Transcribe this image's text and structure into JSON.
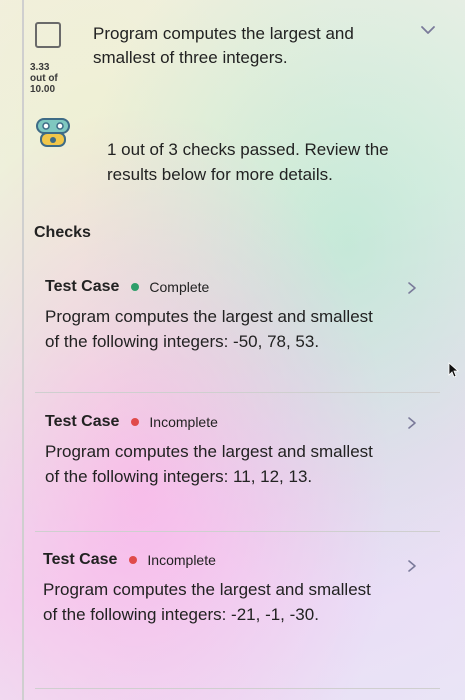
{
  "question": {
    "title": "Program computes the largest and smallest of three integers.",
    "score": "3.33",
    "score_out_of": "out of",
    "score_max": "10.00"
  },
  "summary": "1 out of 3 checks passed. Review the results below for more details.",
  "checks_heading": "Checks",
  "tests": [
    {
      "label": "Test Case",
      "status": "Complete",
      "status_color": "#2e9e6a",
      "description": "Program computes the largest and smallest of the following integers: -50, 78, 53."
    },
    {
      "label": "Test Case",
      "status": "Incomplete",
      "status_color": "#e04a4a",
      "description": "Program computes the largest and smallest of the following integers: 11, 12, 13."
    },
    {
      "label": "Test Case",
      "status": "Incomplete",
      "status_color": "#e04a4a",
      "description": "Program computes the largest and smallest of the following integers: -21, -1, -30."
    }
  ],
  "icons": {
    "expand": "chevron-down-icon",
    "robot": "robot-icon",
    "row_chevron": "chevron-right-icon",
    "cursor": "cursor-icon"
  }
}
